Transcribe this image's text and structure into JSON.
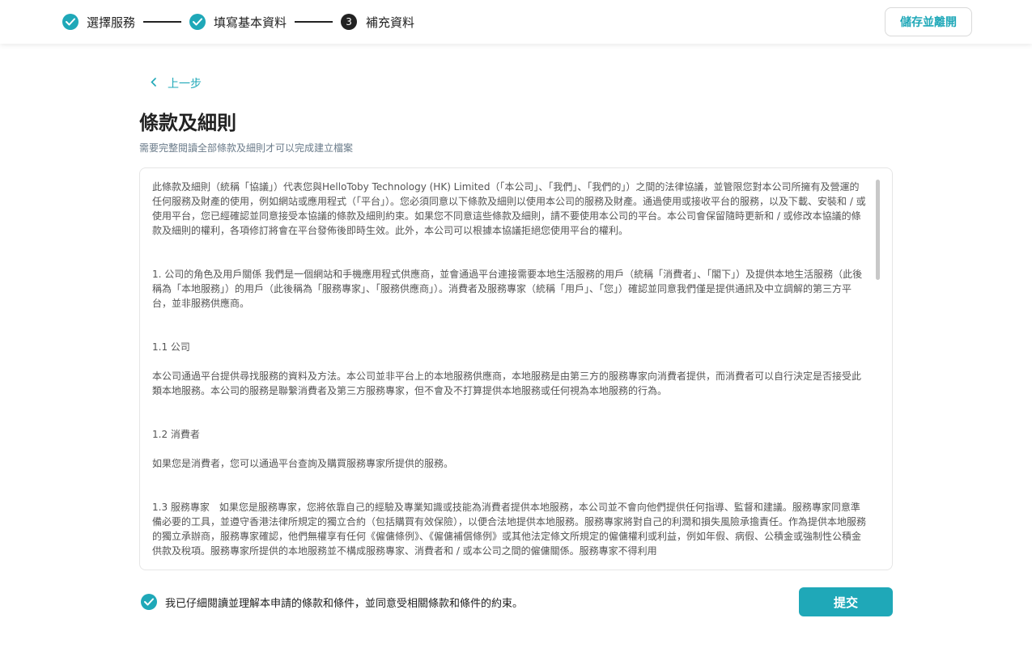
{
  "steps": [
    {
      "label": "選擇服務",
      "state": "done"
    },
    {
      "label": "填寫基本資料",
      "state": "done"
    },
    {
      "label": "補充資料",
      "state": "current",
      "number": "3"
    }
  ],
  "header": {
    "save_label": "儲存並離開"
  },
  "back_label": "上一步",
  "page": {
    "title": "條款及細則",
    "subtitle": "需要完整閱讀全部條款及細則才可以完成建立檔案"
  },
  "terms": [
    "此條款及細則（統稱「協議」）代表您與HelloToby Technology (HK) Limited（「本公司」、「我們」、「我們的」）之間的法律協議，並管限您對本公司所擁有及營運的任何服務及財產的使用，例如網站或應用程式（「平台」）。您必須同意以下條款及細則以使用本公司的服務及財產。通過使用或接收平台的服務，以及下載、安裝和 / 或使用平台，您已經確認並同意接受本協議的條款及細則約束。如果您不同意這些條款及細則，請不要使用本公司的平台。本公司會保留隨時更新和 / 或修改本協議的條款及細則的權利，各項修訂將會在平台發佈後即時生效。此外，本公司可以根據本協議拒絕您使用平台的權利。",
    "1. 公司的角色及用戶關係 我們是一個網站和手機應用程式供應商，並會通過平台連接需要本地生活服務的用戶（統稱「消費者」、「閣下」）及提供本地生活服務（此後稱為「本地服務」）的用戶（此後稱為「服務專家」、「服務供應商」）。消費者及服務專家（統稱「用戶」、「您」）確認並同意我們僅是提供通訊及中立調解的第三方平台，並非服務供應商。",
    "1.1 公司",
    "本公司通過平台提供尋找服務的資料及方法。本公司並非平台上的本地服務供應商，本地服務是由第三方的服務專家向消費者提供，而消費者可以自行決定是否接受此類本地服務。本公司的服務是聯繫消費者及第三方服務專家，但不會及不打算提供本地服務或任何視為本地服務的行為。",
    "1.2 消費者",
    "如果您是消費者，您可以通過平台查詢及購買服務專家所提供的服務。",
    "1.3 服務專家　如果您是服務專家，您將依靠自己的經驗及專業知識或技能為消費者提供本地服務，本公司並不會向他們提供任何指導、監督和建議。服務專家同意準備必要的工具，並遵守香港法律所規定的獨立合約（包括購買有效保險），以便合法地提供本地服務。服務專家將對自己的利潤和損失風險承擔責任。作為提供本地服務的獨立承辦商，服務專家確認，他們無權享有任何《僱傭條例》、《僱傭補償條例》或其他法定條文所規定的僱傭權利或利益，例如年假、病假、公積金或強制性公積金供款及稅項。服務專家所提供的本地服務並不構成服務專家、消費者和 / 或本公司之間的僱傭關係。服務專家不得利用"
  ],
  "agree_label": "我已仔細閱讀並理解本申請的條款和條件，並同意受相關條款和條件的約束。",
  "submit_label": "提交",
  "colors": {
    "accent": "#1fa8b8"
  }
}
